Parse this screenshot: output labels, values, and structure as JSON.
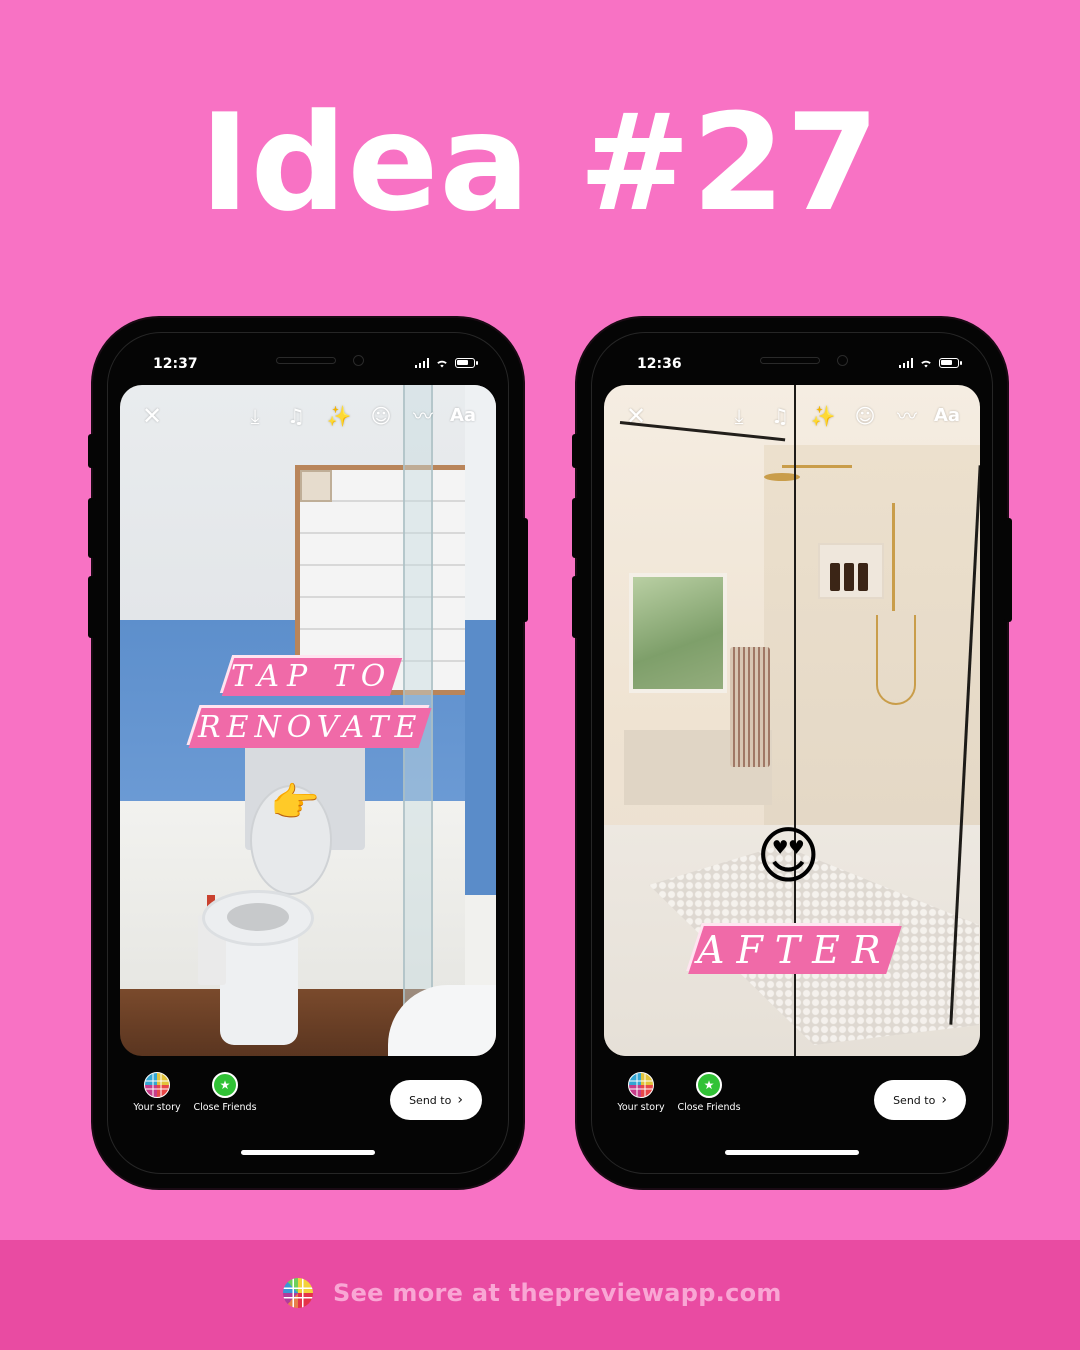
{
  "headline": "Idea #27",
  "colors": {
    "background": "#f872c4",
    "footer": "#e94ba2",
    "footer_text": "#f9a6d4",
    "sticker_pink": "#f06aa8",
    "close_friends_green": "#31c236"
  },
  "phones": [
    {
      "status": {
        "time": "12:37"
      },
      "toolbar": {
        "close_icon": "✕",
        "download_icon": "⤓",
        "music_icon": "♫",
        "effects_icon": "✨",
        "sticker_icon": "☺",
        "draw_icon": "〰",
        "text_label": "Aa"
      },
      "photo": "Bathroom before renovation (blue walls, white toilet, corner shower)",
      "stickers": {
        "line1": "TAP TO",
        "line2": "RENOVATE",
        "emoji": "👉"
      },
      "share": {
        "your_story": "Your story",
        "close_friends": "Close Friends",
        "close_friends_icon": "★",
        "send_label": "Send to",
        "send_chevron": "›"
      }
    },
    {
      "status": {
        "time": "12:36"
      },
      "toolbar": {
        "close_icon": "✕",
        "download_icon": "⤓",
        "music_icon": "♫",
        "effects_icon": "✨",
        "sticker_icon": "☺",
        "draw_icon": "〰",
        "text_label": "Aa"
      },
      "photo": "Bathroom after renovation (walk-in glass shower, gold fixtures)",
      "stickers": {
        "line1": "AFTER",
        "emoji": "😍"
      },
      "share": {
        "your_story": "Your story",
        "close_friends": "Close Friends",
        "close_friends_icon": "★",
        "send_label": "Send to",
        "send_chevron": "›"
      }
    }
  ],
  "footer": {
    "text": "See more at thepreviewapp.com",
    "logo_icon": "preview-app-logo"
  }
}
